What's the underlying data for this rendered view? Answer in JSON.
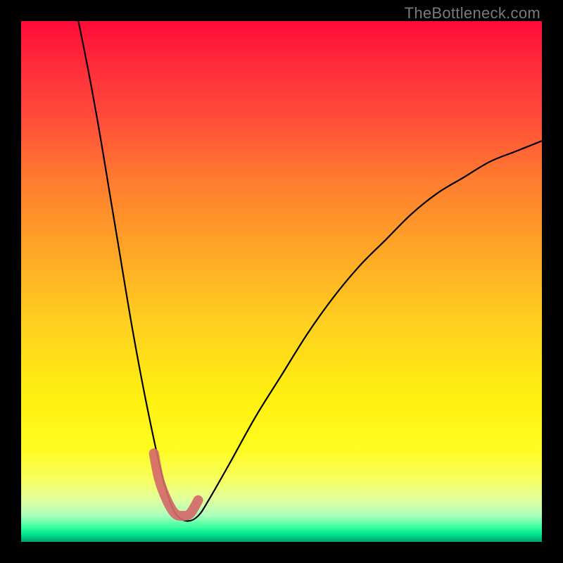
{
  "watermark": "TheBottleneck.com",
  "chart_data": {
    "type": "line",
    "title": "",
    "xlabel": "",
    "ylabel": "",
    "xlim": [
      0,
      100
    ],
    "ylim": [
      0,
      100
    ],
    "series": [
      {
        "name": "curve",
        "x": [
          11,
          13,
          15,
          17,
          19,
          21,
          23,
          25,
          27,
          28.5,
          30,
          32,
          34,
          36,
          40,
          45,
          50,
          55,
          60,
          65,
          70,
          75,
          80,
          85,
          90,
          95,
          100
        ],
        "values": [
          100,
          90,
          79,
          67,
          55,
          43,
          32,
          22,
          13,
          8,
          5,
          4,
          5,
          8,
          15,
          24,
          32,
          40,
          47,
          53,
          58,
          63,
          67,
          70,
          73,
          75,
          77
        ]
      },
      {
        "name": "highlight",
        "x": [
          25.5,
          26.5,
          28,
          29.5,
          31,
          32.5,
          34
        ],
        "values": [
          17,
          12,
          8,
          5.5,
          5,
          5.5,
          8
        ]
      }
    ],
    "gradient_stops": [
      {
        "pos": 0,
        "color": "#ff0a3a"
      },
      {
        "pos": 0.5,
        "color": "#ffd020"
      },
      {
        "pos": 0.95,
        "color": "#40ffa0"
      },
      {
        "pos": 1,
        "color": "#00a070"
      }
    ]
  }
}
